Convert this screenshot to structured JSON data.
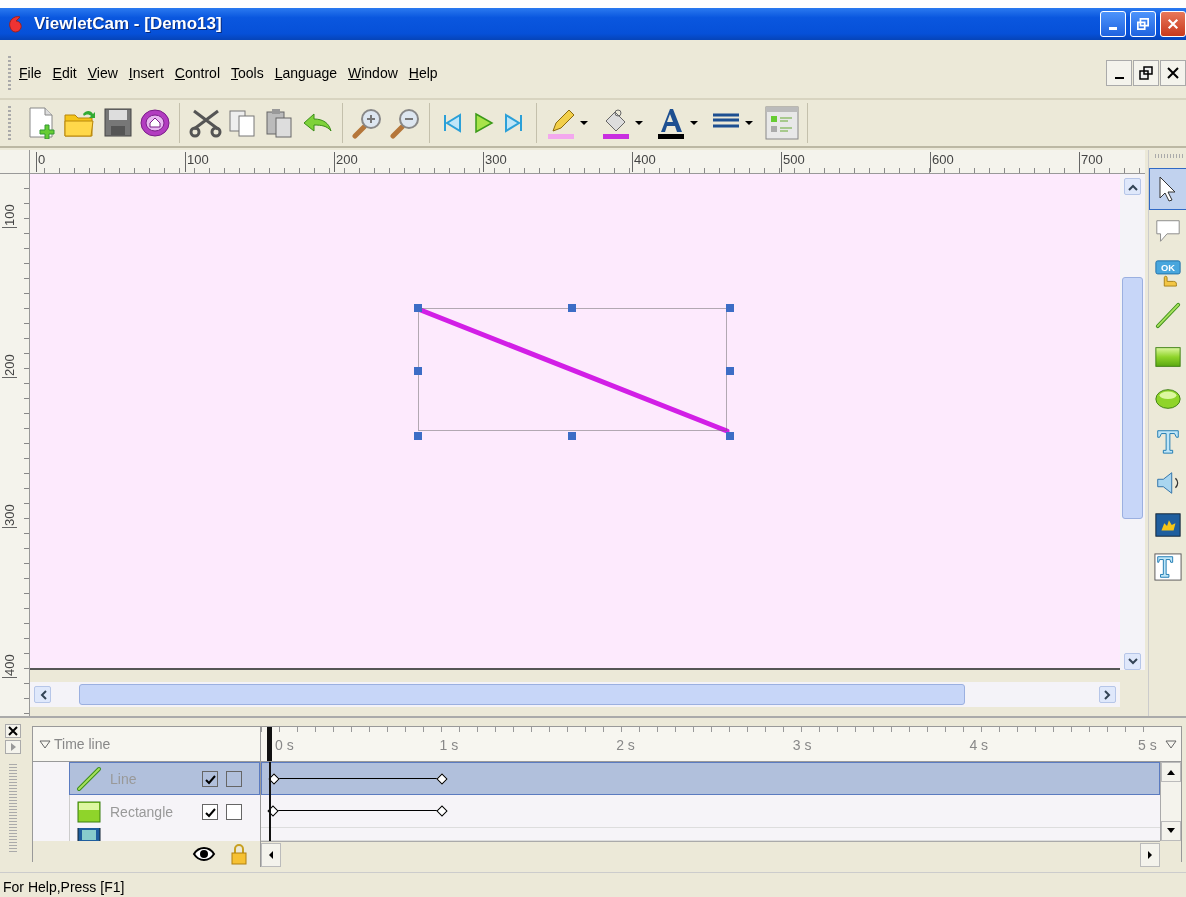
{
  "window": {
    "title": "ViewletCam - [Demo13]"
  },
  "menu": [
    {
      "label": "File"
    },
    {
      "label": "Edit"
    },
    {
      "label": "View"
    },
    {
      "label": "Insert"
    },
    {
      "label": "Control"
    },
    {
      "label": "Tools"
    },
    {
      "label": "Language"
    },
    {
      "label": "Window"
    },
    {
      "label": "Help"
    }
  ],
  "toolbar": {
    "groups": [
      [
        {
          "kind": "new"
        },
        {
          "kind": "open"
        },
        {
          "kind": "save"
        },
        {
          "kind": "publish"
        }
      ],
      [
        {
          "kind": "cut"
        },
        {
          "kind": "copy"
        },
        {
          "kind": "paste"
        },
        {
          "kind": "undo"
        }
      ],
      [
        {
          "kind": "zoom-in"
        },
        {
          "kind": "zoom-out"
        }
      ],
      [
        {
          "kind": "first"
        },
        {
          "kind": "play"
        },
        {
          "kind": "last"
        }
      ]
    ],
    "color_tools": [
      {
        "kind": "pencil",
        "color": "#f3a8ee"
      },
      {
        "kind": "bucket",
        "color": "#c92ee0"
      },
      {
        "kind": "font",
        "color": "#000000"
      },
      {
        "kind": "lines",
        "color": "#1d4f91"
      }
    ],
    "extra": [
      {
        "kind": "properties"
      }
    ]
  },
  "ruler": {
    "x_labels": [
      "0",
      "100",
      "200",
      "300",
      "400",
      "500",
      "600",
      "700"
    ],
    "y_labels": [
      "100",
      "200",
      "300",
      "400"
    ]
  },
  "canvas": {
    "objects": [
      {
        "kind": "line",
        "selected": true
      }
    ]
  },
  "palette": [
    {
      "kind": "pointer",
      "selected": true
    },
    {
      "kind": "callout",
      "selected": false
    },
    {
      "kind": "button",
      "selected": false,
      "text": "OK"
    },
    {
      "kind": "line",
      "selected": false
    },
    {
      "kind": "rectangle",
      "selected": false
    },
    {
      "kind": "ellipse",
      "selected": false
    },
    {
      "kind": "text",
      "selected": false
    },
    {
      "kind": "sound",
      "selected": false
    },
    {
      "kind": "image",
      "selected": false
    },
    {
      "kind": "textbox",
      "selected": false
    }
  ],
  "timeline": {
    "title": "Time line",
    "ticks": [
      "0 s",
      "1 s",
      "2 s",
      "3 s",
      "4 s",
      "5 s"
    ],
    "rows": [
      {
        "kind": "line",
        "name": "Line",
        "selected": true,
        "visible": true,
        "locked": false
      },
      {
        "kind": "rectangle",
        "name": "Rectangle",
        "selected": false,
        "visible": true,
        "locked": false
      },
      {
        "kind": "image"
      }
    ]
  },
  "status_bar": {
    "text": "For Help,Press [F1]"
  }
}
